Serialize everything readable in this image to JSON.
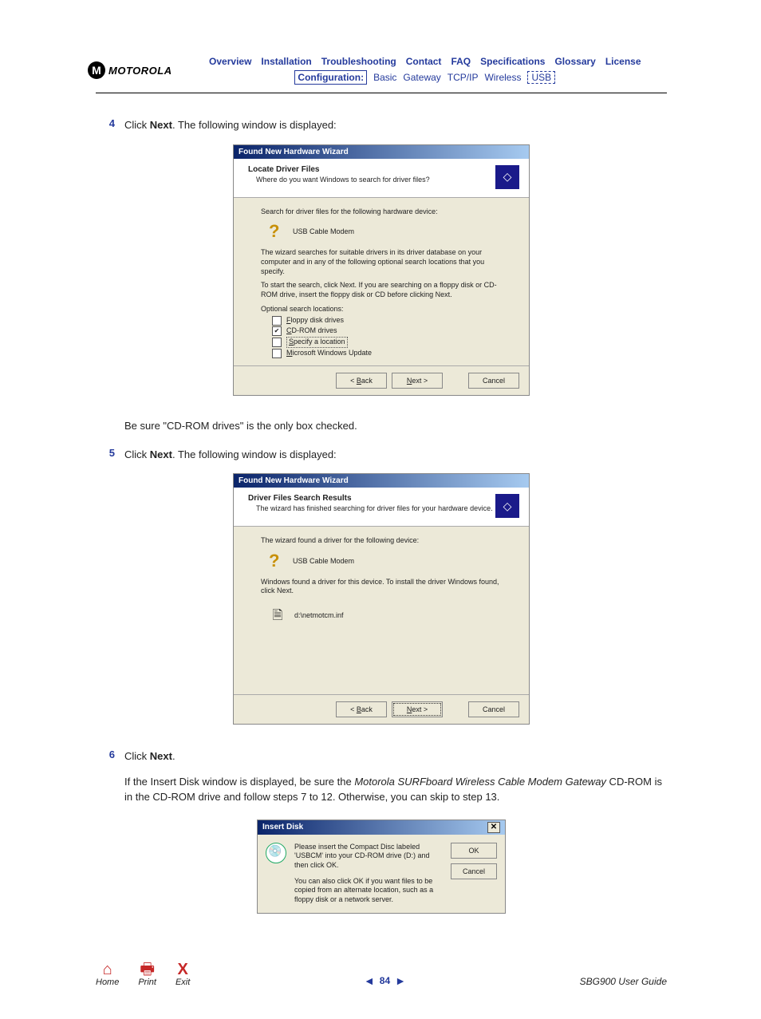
{
  "header": {
    "logo_letter": "M",
    "logo_text": "MOTOROLA",
    "nav1": [
      "Overview",
      "Installation",
      "Troubleshooting",
      "Contact",
      "FAQ",
      "Specifications",
      "Glossary",
      "License"
    ],
    "cfg_label": "Configuration:",
    "cfg_subs": [
      "Basic",
      "Gateway",
      "TCP/IP",
      "Wireless"
    ],
    "cfg_current": "USB"
  },
  "steps": {
    "s4_num": "4",
    "s4_text_a": "Click ",
    "s4_text_b": "Next",
    "s4_text_c": ". The following window is displayed:",
    "s4_note": "Be sure \"CD-ROM drives\" is the only box checked.",
    "s5_num": "5",
    "s5_text_a": "Click ",
    "s5_text_b": "Next",
    "s5_text_c": ". The following window is displayed:",
    "s6_num": "6",
    "s6_text_a": "Click ",
    "s6_text_b": "Next",
    "s6_text_c": ".",
    "s6_para_a": "If the Insert Disk window is displayed, be sure the ",
    "s6_para_b": "Motorola SURFboard Wireless Cable Modem Gateway",
    "s6_para_c": " CD-ROM is in the CD-ROM drive and follow steps 7 to 12. Otherwise, you can skip to step 13."
  },
  "wizard1": {
    "title": "Found New Hardware Wizard",
    "banner_title": "Locate Driver Files",
    "banner_sub": "Where do you want Windows to search for driver files?",
    "line1": "Search for driver files for the following hardware device:",
    "device": "USB Cable Modem",
    "line2": "The wizard searches for suitable drivers in its driver database on your computer and in any of the following optional search locations that you specify.",
    "line3": "To start the search, click Next. If you are searching on a floppy disk or CD-ROM drive, insert the floppy disk or CD before clicking Next.",
    "opt_label": "Optional search locations:",
    "opts": [
      {
        "checked": false,
        "label_pre": "F",
        "label_rest": "loppy disk drives"
      },
      {
        "checked": true,
        "label_pre": "C",
        "label_rest": "D-ROM drives"
      },
      {
        "checked": false,
        "label_pre": "S",
        "label_rest": "pecify a location",
        "boxed": true
      },
      {
        "checked": false,
        "label_pre": "M",
        "label_rest": "icrosoft Windows Update"
      }
    ],
    "btn_back": "< Back",
    "btn_next": "Next >",
    "btn_cancel": "Cancel"
  },
  "wizard2": {
    "title": "Found New Hardware Wizard",
    "banner_title": "Driver Files Search Results",
    "banner_sub": "The wizard has finished searching for driver files for your hardware device.",
    "line1": "The wizard found a driver for the following device:",
    "device": "USB Cable Modem",
    "line2": "Windows found a driver for this device. To install the driver Windows found, click Next.",
    "path": "d:\\netmotcm.inf",
    "btn_back": "< Back",
    "btn_next": "Next >",
    "btn_cancel": "Cancel"
  },
  "dialog3": {
    "title": "Insert Disk",
    "para1": "Please insert the Compact Disc labeled 'USBCM' into your CD-ROM drive (D:) and then click OK.",
    "para2": "You can also click OK if you want files to be copied from an alternate location, such as a floppy disk or a network server.",
    "btn_ok": "OK",
    "btn_cancel": "Cancel",
    "close": "✕"
  },
  "footer": {
    "home": "Home",
    "print": "Print",
    "exit": "Exit",
    "prev": "◄",
    "page": "84",
    "next": "►",
    "guide": "SBG900 User Guide"
  }
}
